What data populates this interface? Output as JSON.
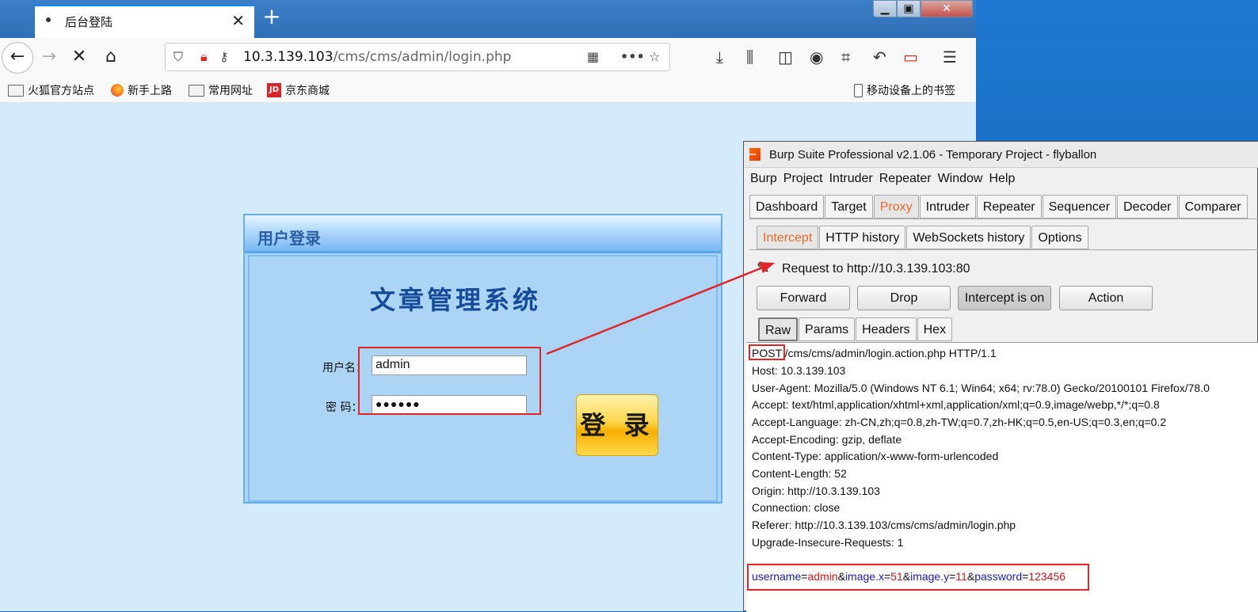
{
  "firefox": {
    "tab_title": "后台登陆",
    "url_host": "10.3.139.103",
    "url_path": "/cms/cms/admin/login.php",
    "bookmarks": [
      "火狐官方站点",
      "新手上路",
      "常用网址",
      "京东商城"
    ],
    "mobile_bookmarks": "移动设备上的书签",
    "jd_icon": "JD"
  },
  "login": {
    "header": "用户登录",
    "system_title": "文章管理系统",
    "username_label": "用户名：",
    "password_label": "密  码：",
    "username_value": "admin",
    "password_value": "●●●●●●",
    "button": "登 录"
  },
  "burp": {
    "title": "Burp Suite Professional v2.1.06 - Temporary Project - flyballon",
    "menu": [
      "Burp",
      "Project",
      "Intruder",
      "Repeater",
      "Window",
      "Help"
    ],
    "tabs": [
      "Dashboard",
      "Target",
      "Proxy",
      "Intruder",
      "Repeater",
      "Sequencer",
      "Decoder",
      "Comparer"
    ],
    "subtabs": [
      "Intercept",
      "HTTP history",
      "WebSockets history",
      "Options"
    ],
    "request_to": "Request to http://10.3.139.103:80",
    "buttons": [
      "Forward",
      "Drop",
      "Intercept is on",
      "Action"
    ],
    "raw_tabs": [
      "Raw",
      "Params",
      "Headers",
      "Hex"
    ],
    "request": {
      "method": "POST",
      "request_line_rest": " /cms/cms/admin/login.action.php HTTP/1.1",
      "headers": [
        "Host: 10.3.139.103",
        "User-Agent: Mozilla/5.0 (Windows NT 6.1; Win64; x64; rv:78.0) Gecko/20100101 Firefox/78.0",
        "Accept: text/html,application/xhtml+xml,application/xml;q=0.9,image/webp,*/*;q=0.8",
        "Accept-Language: zh-CN,zh;q=0.8,zh-TW;q=0.7,zh-HK;q=0.5,en-US;q=0.3,en;q=0.2",
        "Accept-Encoding: gzip, deflate",
        "Content-Type: application/x-www-form-urlencoded",
        "Content-Length: 52",
        "Origin: http://10.3.139.103",
        "Connection: close",
        "Referer: http://10.3.139.103/cms/cms/admin/login.php",
        "Upgrade-Insecure-Requests: 1"
      ],
      "body": [
        {
          "key": "username",
          "value": "admin"
        },
        {
          "key": "image.x",
          "value": "51"
        },
        {
          "key": "image.y",
          "value": "11"
        },
        {
          "key": "password",
          "value": "123456"
        }
      ]
    }
  },
  "colors": {
    "annotation_red": "#e0252b",
    "burp_selected_tab": "#e9692c",
    "param_key": "#1d1d9f",
    "param_value": "#c11a1a"
  }
}
